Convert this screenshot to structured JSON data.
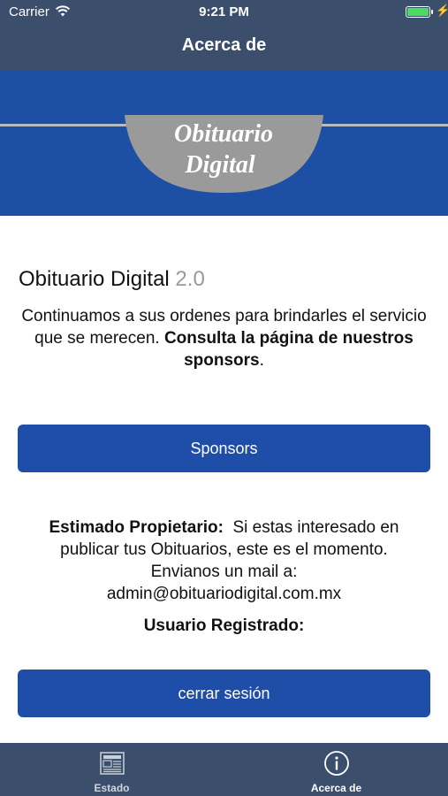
{
  "status_bar": {
    "carrier": "Carrier",
    "time": "9:21 PM",
    "wifi_icon": "wifi-icon",
    "battery_icon": "battery-icon",
    "charging_icon": "bolt-icon"
  },
  "nav": {
    "title": "Acerca de"
  },
  "banner": {
    "logo_line1": "Obituario",
    "logo_line2": "Digital",
    "background_color": "#1d4fa5"
  },
  "about": {
    "app_name": "Obituario Digital",
    "version": "2.0",
    "intro_text": "Continuamos a sus ordenes para brindarles el servicio que se merecen.",
    "intro_bold": "Consulta la página de nuestros sponsors",
    "intro_end": "."
  },
  "buttons": {
    "sponsors_label": "Sponsors",
    "logout_label": "cerrar sesión",
    "accent_color": "#1f4ea9"
  },
  "owner": {
    "bold_label": "Estimado Propietario:",
    "text": "Si estas interesado en publicar tus Obituarios, este es el momento.",
    "mail_prompt": "Envianos un mail a:",
    "email": "admin@obituariodigital.com.mx"
  },
  "registered_label": "Usuario Registrado:",
  "tabbar": {
    "tabs": [
      {
        "label": "Estado",
        "icon": "newspaper-icon",
        "selected": false
      },
      {
        "label": "Acerca de",
        "icon": "info-icon",
        "selected": true
      }
    ],
    "background_color": "#3b4e6b"
  }
}
